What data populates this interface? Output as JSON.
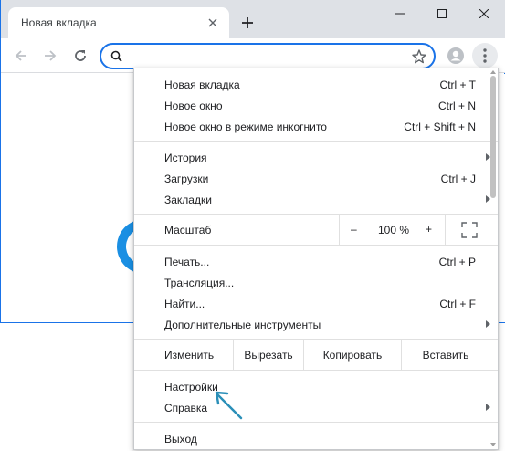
{
  "tab": {
    "title": "Новая вкладка"
  },
  "omnibox": {
    "value": ""
  },
  "menu": {
    "group1": [
      {
        "label": "Новая вкладка",
        "shortcut": "Ctrl + T"
      },
      {
        "label": "Новое окно",
        "shortcut": "Ctrl + N"
      },
      {
        "label": "Новое окно в режиме инкогнито",
        "shortcut": "Ctrl + Shift + N"
      }
    ],
    "group2": [
      {
        "label": "История",
        "shortcut": ""
      },
      {
        "label": "Загрузки",
        "shortcut": "Ctrl + J"
      },
      {
        "label": "Закладки",
        "shortcut": ""
      }
    ],
    "zoom": {
      "label": "Масштаб",
      "minus": "–",
      "value": "100 %",
      "plus": "+"
    },
    "group3": [
      {
        "label": "Печать...",
        "shortcut": "Ctrl + P"
      },
      {
        "label": "Трансляция...",
        "shortcut": ""
      },
      {
        "label": "Найти...",
        "shortcut": "Ctrl + F"
      },
      {
        "label": "Дополнительные инструменты",
        "shortcut": ""
      }
    ],
    "edit": {
      "label": "Изменить",
      "cut": "Вырезать",
      "copy": "Копировать",
      "paste": "Вставить"
    },
    "group4": [
      {
        "label": "Настройки"
      },
      {
        "label": "Справка"
      }
    ],
    "exit": {
      "label": "Выход"
    }
  },
  "colors": {
    "accent": "#1a73e8",
    "titlebar": "#dee1e6",
    "arrow_annotation": "#2a8fb8"
  }
}
